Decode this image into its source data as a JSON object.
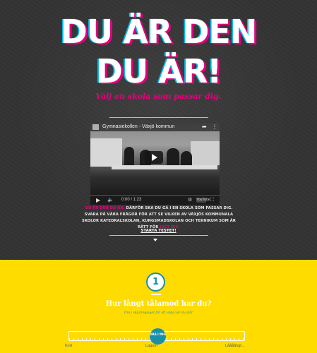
{
  "hero": {
    "headline_line1": "DU ÄR DEN",
    "headline_line2": "DU ÄR!",
    "tagline": "Välj en skola som passar dig."
  },
  "video": {
    "title": "Gymnasiekollen - Växjö kommun",
    "time": "0:00 / 1:23",
    "logo_text": "YouTube"
  },
  "intro": {
    "highlight": "DU ÄR DEN DU ÄR.",
    "text": " DÄRFÖR SKA DU GÅ I EN SKOLA SOM PASSAR DIG. SVARA PÅ VÅRA FRÅGOR FÖR ATT SE VILKEN AV VÄXJÖS KOMMUNALA SKOLOR KATEDRALSKOLAN, KUNGSMADSKOLAN OCH TEKNIKUM SOM ÄR RÄTT FÖR ",
    "highlight_end": "JUST DIG."
  },
  "start_label": "STARTA TESTET!",
  "question": {
    "number": "1",
    "title": "Hur långt tålamod har du?",
    "subtitle": "Dra i skjutreglaget för att välja var du står",
    "handle_label": "DRA I MIG",
    "value_fraction": 0.5,
    "labels": [
      "Kort",
      "Lagom",
      "Låååångt..."
    ]
  },
  "colors": {
    "accent_pink": "#e6007e",
    "accent_cyan": "#00b9e8",
    "teal": "#1a8fa8",
    "yellow": "#ffdc00",
    "chalkboard": "#333333"
  }
}
